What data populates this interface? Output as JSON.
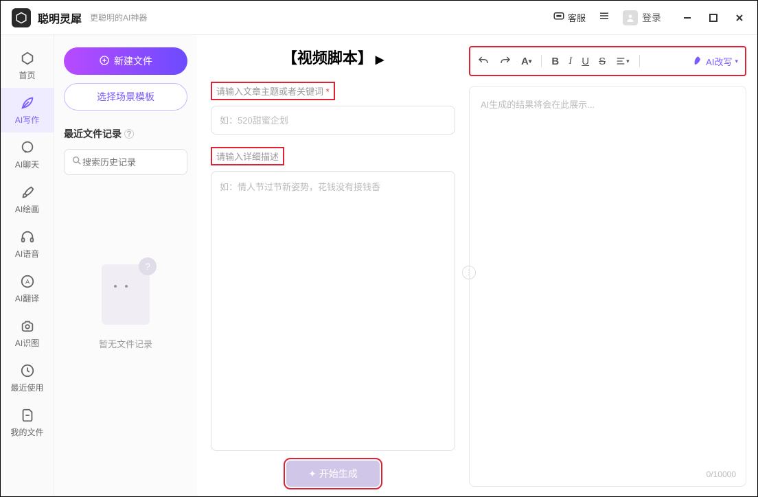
{
  "app": {
    "name": "聪明灵犀",
    "tagline": "更聪明的AI神器"
  },
  "titlebar": {
    "support": "客服",
    "login": "登录"
  },
  "sidebar": {
    "items": [
      {
        "label": "首页"
      },
      {
        "label": "AI写作"
      },
      {
        "label": "AI聊天"
      },
      {
        "label": "AI绘画"
      },
      {
        "label": "AI语音"
      },
      {
        "label": "AI翻译"
      },
      {
        "label": "AI识图"
      },
      {
        "label": "最近使用"
      },
      {
        "label": "我的文件"
      }
    ]
  },
  "filepanel": {
    "new_file": "新建文件",
    "template": "选择场景模板",
    "recent": "最近文件记录",
    "search_placeholder": "搜索历史记录",
    "empty": "暂无文件记录"
  },
  "form": {
    "title": "【视频脚本】",
    "label_topic": "请输入文章主题或者关键词",
    "placeholder_topic": "如：520甜蜜企划",
    "label_detail": "请输入详细描述",
    "placeholder_detail": "如：情人节过节新姿势，花钱没有接钱香",
    "generate": "开始生成"
  },
  "result": {
    "placeholder": "AI生成的结果将会在此展示...",
    "counter": "0/10000",
    "ai_rewrite": "AI改写"
  }
}
